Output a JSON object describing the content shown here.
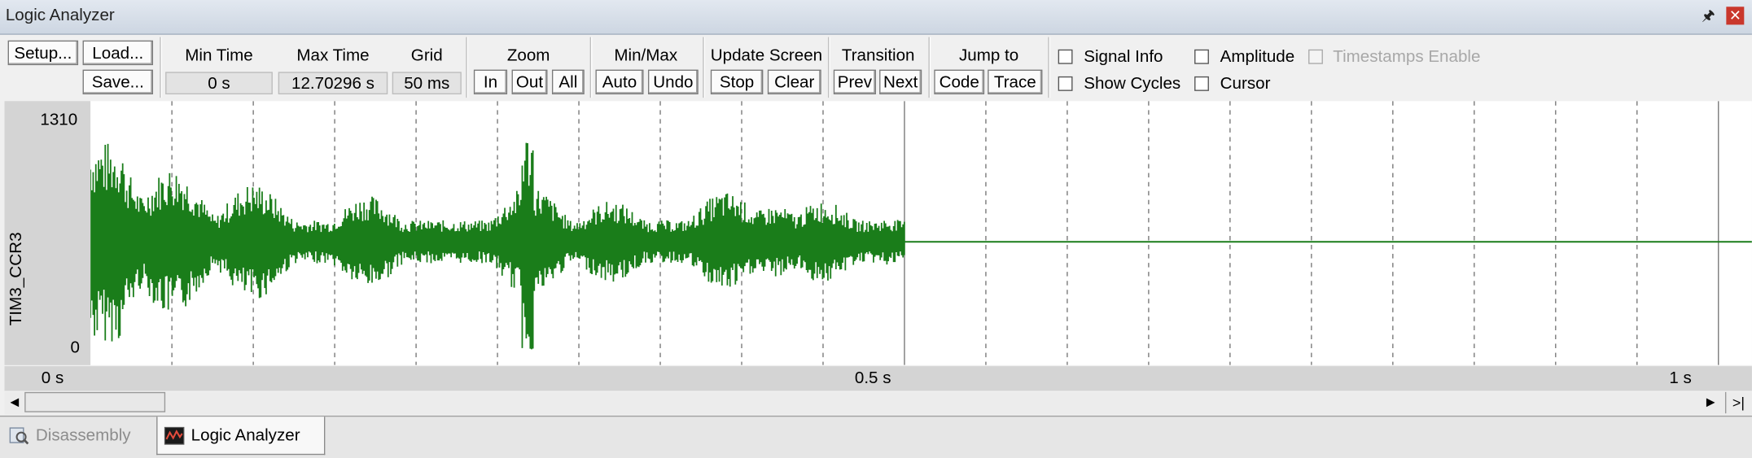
{
  "window": {
    "title": "Logic Analyzer"
  },
  "toolbar": {
    "setup": "Setup...",
    "load": "Load...",
    "save": "Save...",
    "min_time_label": "Min Time",
    "min_time_value": "0 s",
    "max_time_label": "Max Time",
    "max_time_value": "12.70296 s",
    "grid_label": "Grid",
    "grid_value": "50 ms",
    "zoom_label": "Zoom",
    "zoom_in": "In",
    "zoom_out": "Out",
    "zoom_all": "All",
    "minmax_label": "Min/Max",
    "auto": "Auto",
    "undo": "Undo",
    "update_label": "Update Screen",
    "stop": "Stop",
    "clear": "Clear",
    "transition_label": "Transition",
    "prev": "Prev",
    "next": "Next",
    "jump_label": "Jump to",
    "code": "Code",
    "trace": "Trace",
    "signal_info": "Signal Info",
    "amplitude": "Amplitude",
    "timestamps": "Timestamps Enable",
    "show_cycles": "Show Cycles",
    "cursor": "Cursor"
  },
  "plot": {
    "signal_name": "TIM3_CCR3",
    "y_max_label": "1310",
    "y_min_label": "0",
    "x_labels": [
      "0 s",
      "0.5 s",
      "1 s"
    ],
    "color": "#1a7d1a"
  },
  "chart_data": {
    "type": "line",
    "series": [
      {
        "name": "TIM3_CCR3",
        "color": "#1a7d1a"
      }
    ],
    "ylim": [
      0,
      1310
    ],
    "xlim": [
      0,
      1.0
    ],
    "x_ticks": [
      "0 s",
      "0.5 s",
      "1 s"
    ],
    "grid": "vertical, dashed, 50 ms",
    "active_until_s": 0.5,
    "steady_value": 600
  },
  "tabs": [
    {
      "label": "Disassembly",
      "active": false
    },
    {
      "label": "Logic Analyzer",
      "active": true
    }
  ]
}
